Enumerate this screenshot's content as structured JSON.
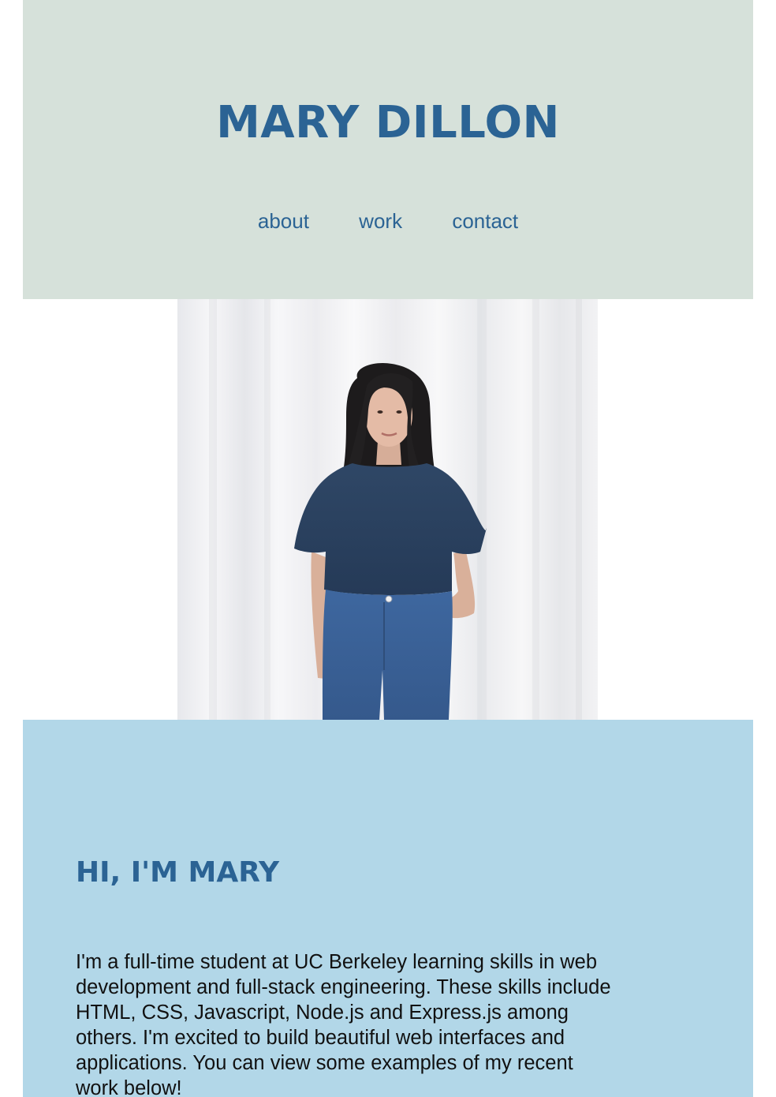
{
  "header": {
    "title": "MARY DILLON",
    "nav": [
      {
        "label": "about"
      },
      {
        "label": "work"
      },
      {
        "label": "contact"
      }
    ]
  },
  "hero": {
    "photo": "portrait of a woman in a navy linen top and blue jeans standing before a white curtain"
  },
  "about": {
    "heading": "HI, I'M MARY",
    "text": "I'm a full-time student at UC Berkeley learning skills in web development and full-stack engineering. These skills include HTML, CSS, Javascript, Node.js and Express.js among others. I'm excited to build beautiful web interfaces and applications. You can view some examples of my recent work below!"
  },
  "colors": {
    "header_bg": "#d6e1da",
    "accent": "#2b6394",
    "about_bg": "#b2d7e8"
  }
}
